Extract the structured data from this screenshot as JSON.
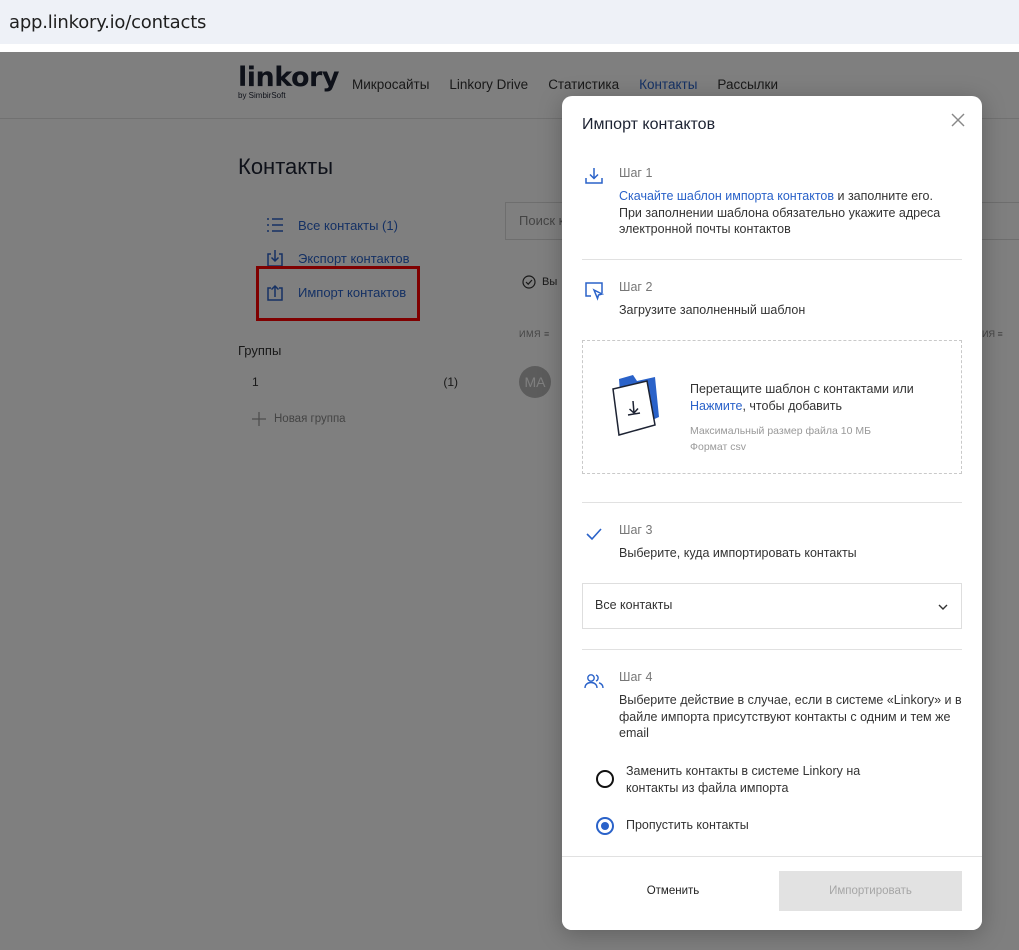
{
  "browser": {
    "url": "app.linkory.io/contacts"
  },
  "brand": {
    "logo": "linkory",
    "by": "by SimbirSoft",
    "accent": "#2a62c9"
  },
  "nav": {
    "items": [
      "Микросайты",
      "Linkory Drive",
      "Статистика",
      "Контакты",
      "Рассылки"
    ],
    "active": "Контакты"
  },
  "page": {
    "title": "Контакты"
  },
  "sidebar": {
    "all_contacts": "Все контакты (1)",
    "export": "Экспорт контактов",
    "import": "Импорт контактов",
    "groups_title": "Группы",
    "group": {
      "name": "1",
      "count": "(1)"
    },
    "new_group": "Новая группа"
  },
  "main": {
    "search_placeholder": "Поиск к",
    "select_label": "Вы",
    "col_name": "ИМЯ",
    "col_right": "ИЯ",
    "avatar_initials": "МА"
  },
  "modal": {
    "title": "Импорт контактов",
    "step1": {
      "label": "Шаг 1",
      "link": "Скачайте шаблон импорта контактов",
      "text_after_link": " и заполните его.",
      "text_rest": "При заполнении шаблона обязательно укажите адреса электронной почты контактов"
    },
    "step2": {
      "label": "Шаг 2",
      "text": "Загрузите заполненный шаблон"
    },
    "dropzone": {
      "text": "Перетащите шаблон с контактами или",
      "link": "Нажмите",
      "text_after_link": ", чтобы добавить",
      "max_size": "Максимальный размер файла 10 МБ",
      "format": "Формат csv"
    },
    "step3": {
      "label": "Шаг 3",
      "text": "Выберите, куда импортировать контакты",
      "selected": "Все контакты"
    },
    "step4": {
      "label": "Шаг 4",
      "text": "Выберите действие в случае, если в системе «Linkory» и в файле импорта присутствуют контакты с одним и тем же email",
      "options": [
        {
          "label": "Заменить контакты в системе Linkory на контакты из файла импорта",
          "selected": false
        },
        {
          "label": "Пропустить контакты",
          "selected": true
        }
      ]
    },
    "cancel": "Отменить",
    "import": "Импортировать"
  }
}
